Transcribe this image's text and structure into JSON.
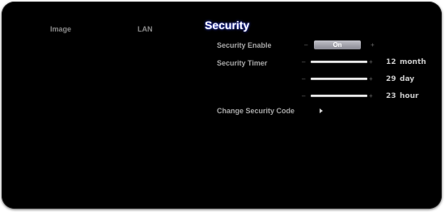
{
  "tabs": {
    "image": "Image",
    "lan": "LAN",
    "security": "Security"
  },
  "security_enable": {
    "label": "Security Enable",
    "minus": "–",
    "plus": "+",
    "value": "On"
  },
  "security_timer": {
    "label": "Security Timer",
    "rows": [
      {
        "minus": "–",
        "plus": "+",
        "number": "12",
        "unit": "month"
      },
      {
        "minus": "–",
        "plus": "+",
        "number": "29",
        "unit": "day"
      },
      {
        "minus": "–",
        "plus": "+",
        "number": "23",
        "unit": "hour"
      }
    ]
  },
  "change_code": {
    "label": "Change Security Code"
  }
}
